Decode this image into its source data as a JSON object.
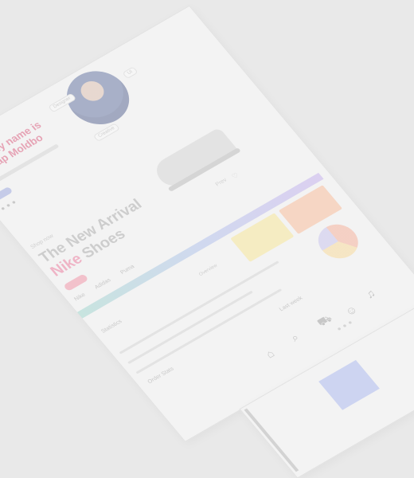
{
  "profile": {
    "greeting": "Hello, my name is Songlap Moldbo",
    "tags": [
      "Designer",
      "UI",
      "Creative"
    ]
  },
  "hero": {
    "kicker": "Shop now",
    "title_prefix": "The New Arrival",
    "title_accent": "Nike",
    "title_suffix": "Shoes",
    "brands": "Nike Adidas Puma",
    "prev_label": "Prev",
    "fav_icon": "heart-icon"
  },
  "dashboard": {
    "label": "Statistics",
    "pill": "Overview",
    "small": "Order Stats",
    "legend": "Last week"
  },
  "icons": [
    "home-icon",
    "search-icon",
    "cart-icon",
    "user-icon",
    "bell-icon"
  ]
}
